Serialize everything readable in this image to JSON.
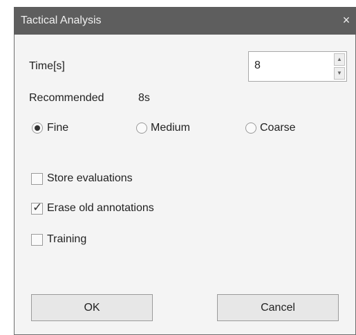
{
  "window": {
    "title": "Tactical Analysis",
    "close_glyph": "×"
  },
  "time": {
    "label": "Time[s]",
    "value": "8"
  },
  "recommended": {
    "label": "Recommended",
    "value": "8s"
  },
  "resolution": {
    "options": [
      {
        "label": "Fine",
        "selected": true
      },
      {
        "label": "Medium",
        "selected": false
      },
      {
        "label": "Coarse",
        "selected": false
      }
    ]
  },
  "checkboxes": [
    {
      "label": "Store evaluations",
      "checked": false
    },
    {
      "label": "Erase old annotations",
      "checked": true
    },
    {
      "label": "Training",
      "checked": false
    }
  ],
  "buttons": {
    "ok_label": "OK",
    "cancel_label": "Cancel"
  },
  "icons": {
    "spin_up": "up-arrow-icon",
    "spin_down": "down-arrow-icon",
    "close": "close-icon",
    "check": "checkmark-icon"
  }
}
